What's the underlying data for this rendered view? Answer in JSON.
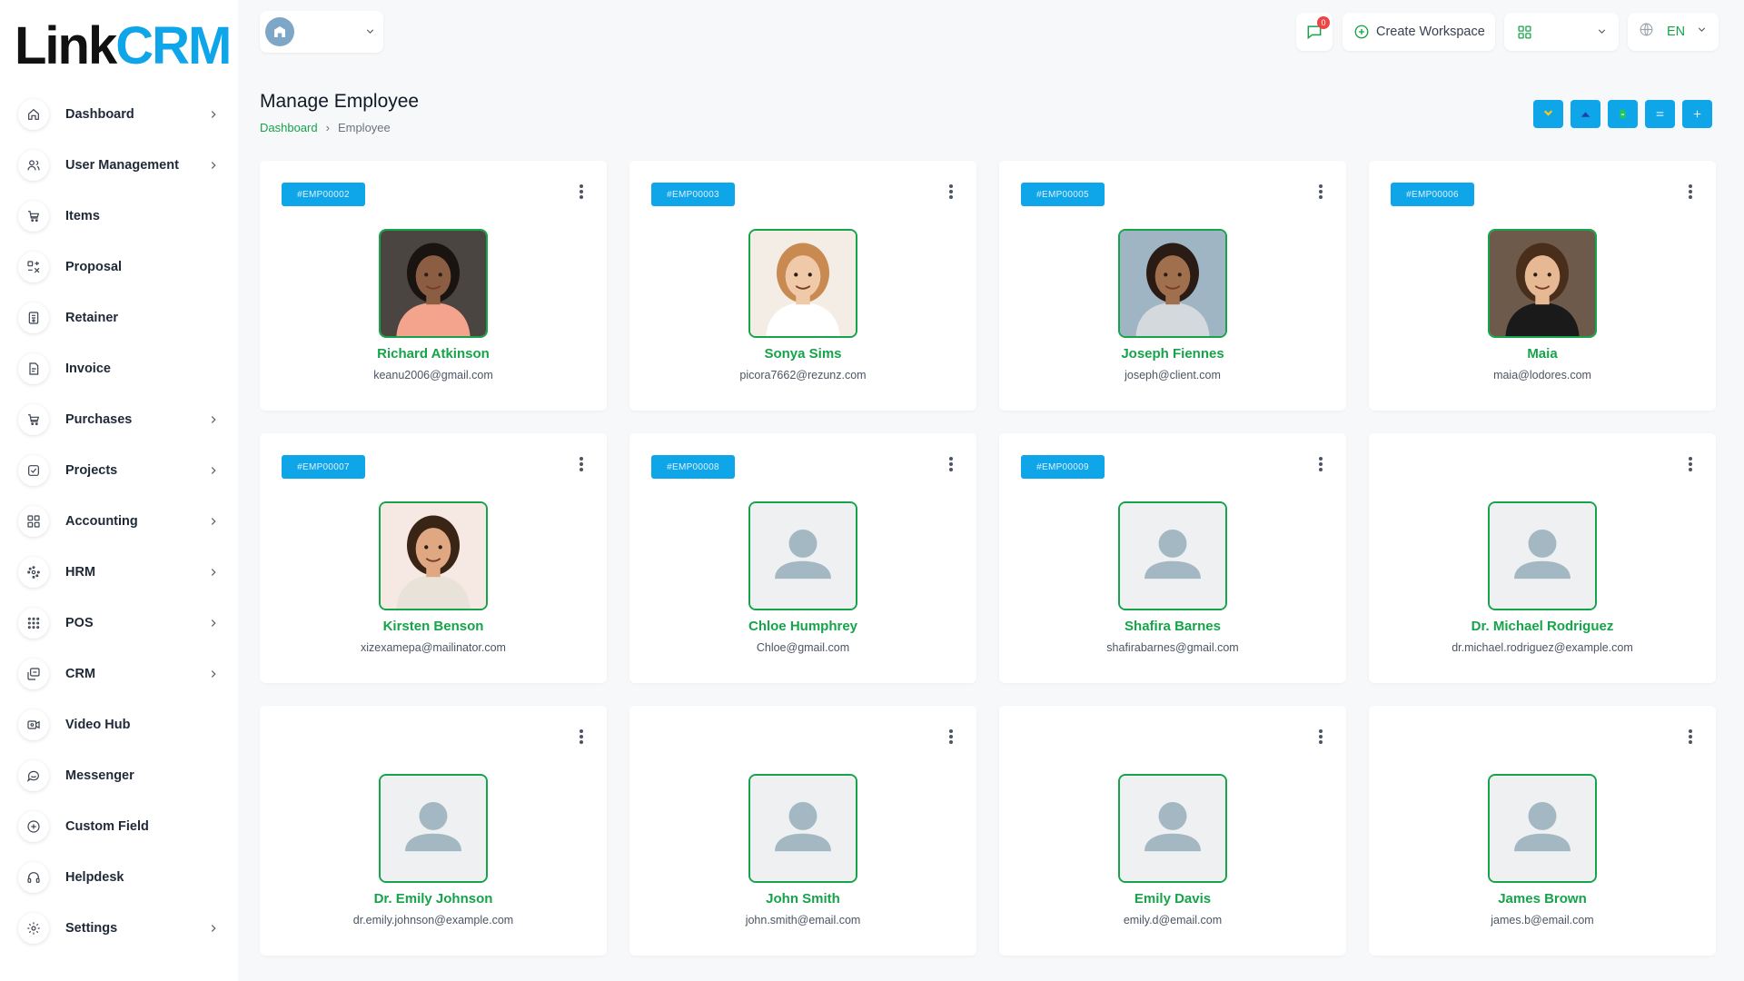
{
  "brand": {
    "part1": "Link",
    "part2": "CRM"
  },
  "topbar": {
    "notification_count": "0",
    "create_workspace_label": "Create Workspace",
    "language_code": "EN"
  },
  "sidebar": {
    "items": [
      {
        "label": "Dashboard",
        "icon": "home-icon",
        "chevron": true
      },
      {
        "label": "User Management",
        "icon": "users-icon",
        "chevron": true
      },
      {
        "label": "Items",
        "icon": "cart-icon",
        "chevron": false
      },
      {
        "label": "Proposal",
        "icon": "proposal-icon",
        "chevron": false
      },
      {
        "label": "Retainer",
        "icon": "retainer-icon",
        "chevron": false
      },
      {
        "label": "Invoice",
        "icon": "invoice-icon",
        "chevron": false
      },
      {
        "label": "Purchases",
        "icon": "cart-icon",
        "chevron": true
      },
      {
        "label": "Projects",
        "icon": "checkbox-icon",
        "chevron": true
      },
      {
        "label": "Accounting",
        "icon": "grid-icon",
        "chevron": true
      },
      {
        "label": "HRM",
        "icon": "hrm-icon",
        "chevron": true
      },
      {
        "label": "POS",
        "icon": "dots-grid-icon",
        "chevron": true
      },
      {
        "label": "CRM",
        "icon": "crm-icon",
        "chevron": true
      },
      {
        "label": "Video Hub",
        "icon": "video-icon",
        "chevron": false
      },
      {
        "label": "Messenger",
        "icon": "chat-icon",
        "chevron": false
      },
      {
        "label": "Custom Field",
        "icon": "plus-circle-icon",
        "chevron": false
      },
      {
        "label": "Helpdesk",
        "icon": "headset-icon",
        "chevron": false
      },
      {
        "label": "Settings",
        "icon": "gear-icon",
        "chevron": true
      }
    ]
  },
  "header": {
    "title": "Manage Employee",
    "breadcrumb": {
      "home": "Dashboard",
      "current": "Employee"
    }
  },
  "actions": [
    {
      "icon": "import-icon"
    },
    {
      "icon": "upload-icon"
    },
    {
      "icon": "export-icon"
    },
    {
      "icon": "list-view-icon"
    },
    {
      "icon": "add-icon"
    }
  ],
  "employees": [
    {
      "id": "#EMP00002",
      "name": "Richard Atkinson",
      "email": "keanu2006@gmail.com",
      "photo": true,
      "bg": "#4a4540",
      "skin": "#8b5e44",
      "hair": "#1a1410",
      "shirt": "#f4a38c"
    },
    {
      "id": "#EMP00003",
      "name": "Sonya Sims",
      "email": "picora7662@rezunz.com",
      "photo": true,
      "bg": "#f4ede6",
      "skin": "#f0c9a8",
      "hair": "#c98a52",
      "shirt": "#ffffff"
    },
    {
      "id": "#EMP00005",
      "name": "Joseph Fiennes",
      "email": "joseph@client.com",
      "photo": true,
      "bg": "#9fb5c4",
      "skin": "#a0704e",
      "hair": "#2a1c14",
      "shirt": "#d4d9dd"
    },
    {
      "id": "#EMP00006",
      "name": "Maia",
      "email": "maia@lodores.com",
      "photo": true,
      "bg": "#6d5a4a",
      "skin": "#e6b894",
      "hair": "#4a2e1c",
      "shirt": "#1a1a1a"
    },
    {
      "id": "#EMP00007",
      "name": "Kirsten Benson",
      "email": "xizexamepa@mailinator.com",
      "photo": true,
      "bg": "#f6e9e4",
      "skin": "#e0a882",
      "hair": "#3a2416",
      "shirt": "#e8e2d8"
    },
    {
      "id": "#EMP00008",
      "name": "Chloe Humphrey",
      "email": "Chloe@gmail.com",
      "photo": false
    },
    {
      "id": "#EMP00009",
      "name": "Shafira Barnes",
      "email": "shafirabarnes@gmail.com",
      "photo": false
    },
    {
      "id": "",
      "name": "Dr. Michael Rodriguez",
      "email": "dr.michael.rodriguez@example.com",
      "photo": false
    },
    {
      "id": "",
      "name": "Dr. Emily Johnson",
      "email": "dr.emily.johnson@example.com",
      "photo": false
    },
    {
      "id": "",
      "name": "John Smith",
      "email": "john.smith@email.com",
      "photo": false
    },
    {
      "id": "",
      "name": "Emily Davis",
      "email": "emily.d@email.com",
      "photo": false
    },
    {
      "id": "",
      "name": "James Brown",
      "email": "james.b@email.com",
      "photo": false
    }
  ],
  "colors": {
    "accent": "#16a34a",
    "badge": "#0ea5e9",
    "notification": "#ef4444",
    "placeholder": "#a3b8c2"
  }
}
